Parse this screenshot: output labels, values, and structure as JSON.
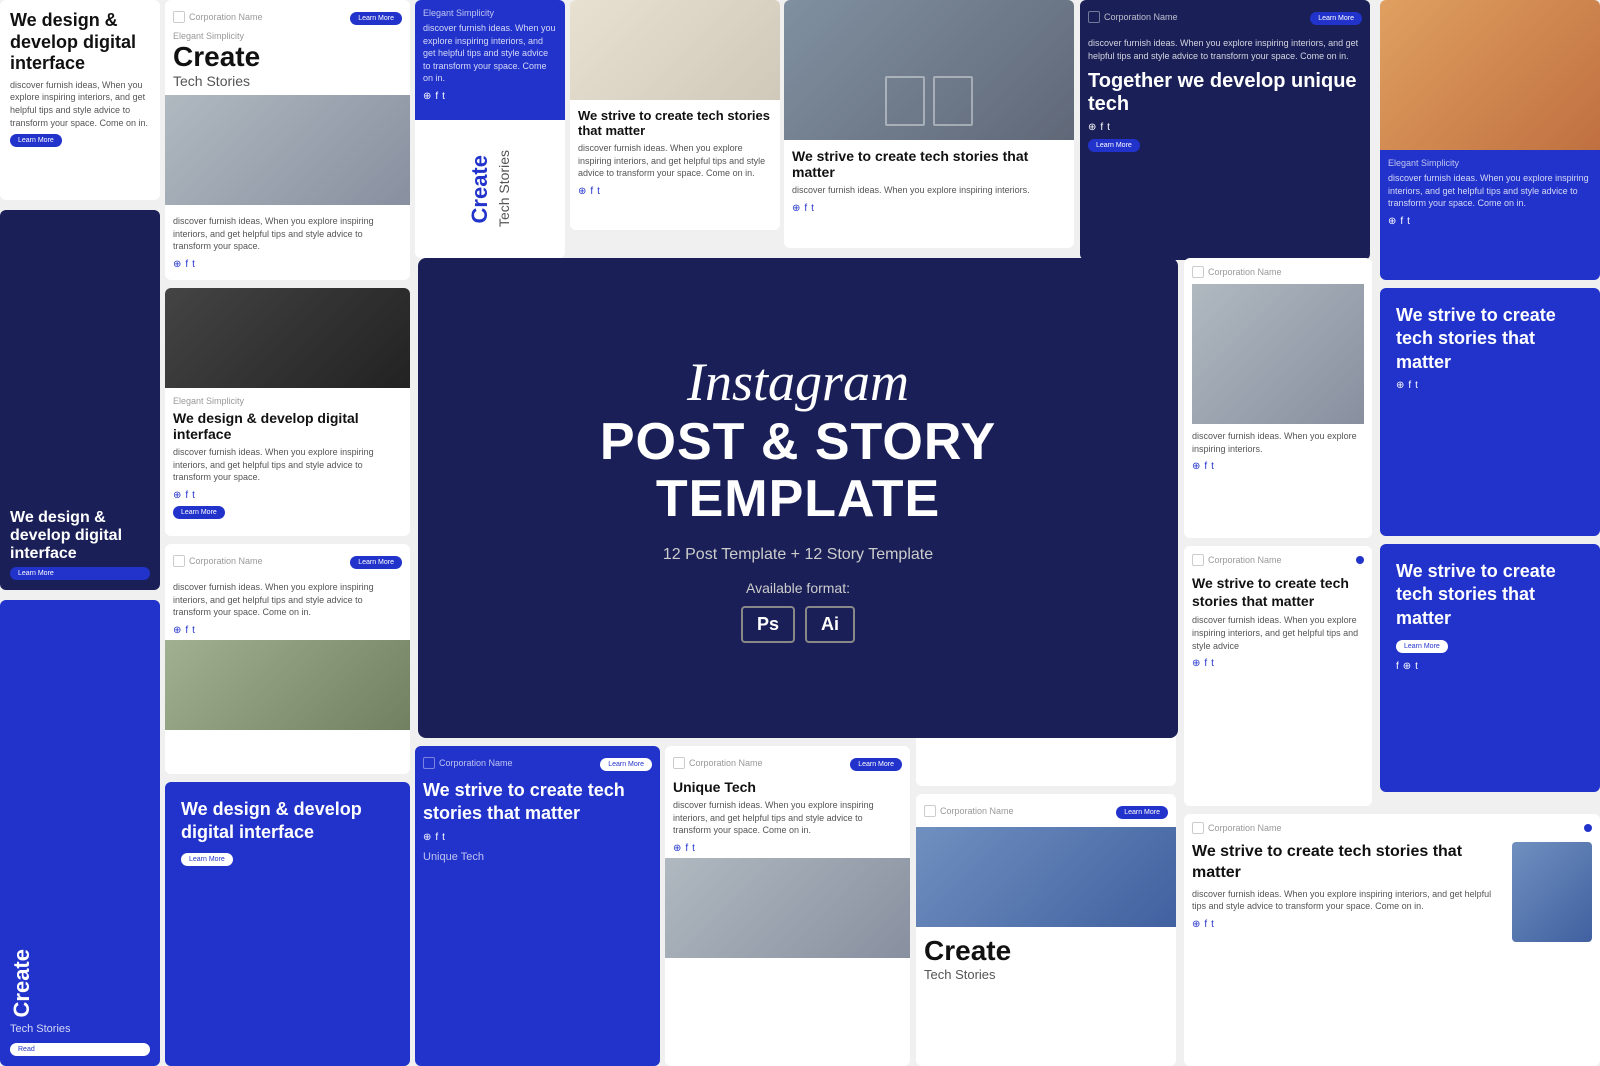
{
  "center": {
    "script_title": "Instagram",
    "block_line1": "POST & STORY",
    "block_line2": "TEMPLATE",
    "subtitle": "12 Post Template + 12 Story Template",
    "format_label": "Available format:",
    "format1": "Ps",
    "format2": "Ai"
  },
  "cards": {
    "tl_title": "We design & develop digital interface",
    "tl_body": "discover furnish ideas, When you explore inspiring interiors, and get helpful tips and style advice to transform your space. Come on in.",
    "post1_brand": "Corporation Name",
    "post1_label": "Elegant Simplicity",
    "post1_title": "Create",
    "post1_subtitle": "Tech Stories",
    "post1_body": "discover furnish ideas, When you explore inspiring interiors, and get helpful tips and style advice to transform your space.",
    "story1_label": "Elegant Simplicity",
    "story1_body": "discover furnish ideas. When you explore inspiring interiors, and get helpful tips and style advice to transform your space. Come on in.",
    "story1_vertical": "Create Tech Stories",
    "post2_title": "We strive to create tech stories that matter",
    "post2_body": "discover furnish ideas. When you explore inspiring interiors, and get helpful tips and style advice to transform your space. Come on in.",
    "post3_title": "We strive to create tech stories that matter",
    "post3_body": "discover furnish ideas. When you explore inspiring interiors.",
    "post4_brand": "Corporation Name",
    "post4_title": "Together we develop unique tech",
    "post4_body": "discover furnish ideas. When you explore inspiring interiors, and get helpful tips and style advice to transform your space. Come on in.",
    "story2_label": "Elegant Simplicity",
    "story2_body": "discover furnish ideas. When you explore inspiring interiors, and get helpful tips and style advice to transform your space. Come on in.",
    "post5_label": "Elegant Simplicity",
    "post5_title": "We design & develop digital interface",
    "post5_body": "discover furnish ideas. When you explore inspiring interiors, and get helpful tips and style advice to transform your space.",
    "post6_title": "We strive to create tech stories that matter",
    "post6_body": "discover furnish ideas. When you explore inspiring interiors, and get helpful tips and style advice to transform your space.",
    "story4_title": "We strive to create tech stories that matter",
    "story5_title": "We design & develop digital interface",
    "post7_brand": "Corporation Name",
    "post7_body": "discover furnish ideas. When you explore inspiring interiors, and get helpful tips and style advice to transform your space. Come on in.",
    "story6_title": "We design & develop digital interface",
    "post8_brand": "Corporation Name",
    "post8_title": "We strive to create tech stories that matter",
    "post9_title": "Unique Tech",
    "post9_brand": "Corporation Name",
    "post9_body": "discover furnish ideas. When you explore inspiring interiors, and get helpful tips and style advice to transform your space. Come on in.",
    "post10_brand": "Corporation Name",
    "post10_title": "We strive to create tech stories that matter",
    "post10_body": "discover furnish ideas. When you explore inspiring interiors, and get helpful tips and style advice",
    "post11_brand": "Corporation Name",
    "post11_title": "Create",
    "post11_subtitle": "Tech Stories",
    "story7_title": "We strive to create tech stories that matter",
    "post12_brand": "Corporation Name",
    "post13_title": "We strive to create tech stories that matter",
    "post13_body": "discover furnish ideas. When you explore inspiring interiors, and get helpful tips and style advice",
    "post14_brand": "Corporation Name",
    "post14_title": "We strive to create tech stories that matter",
    "post14_body": "discover furnish ideas. When you explore inspiring interiors, and get helpful tips and style advice to transform your space. Come on in."
  }
}
